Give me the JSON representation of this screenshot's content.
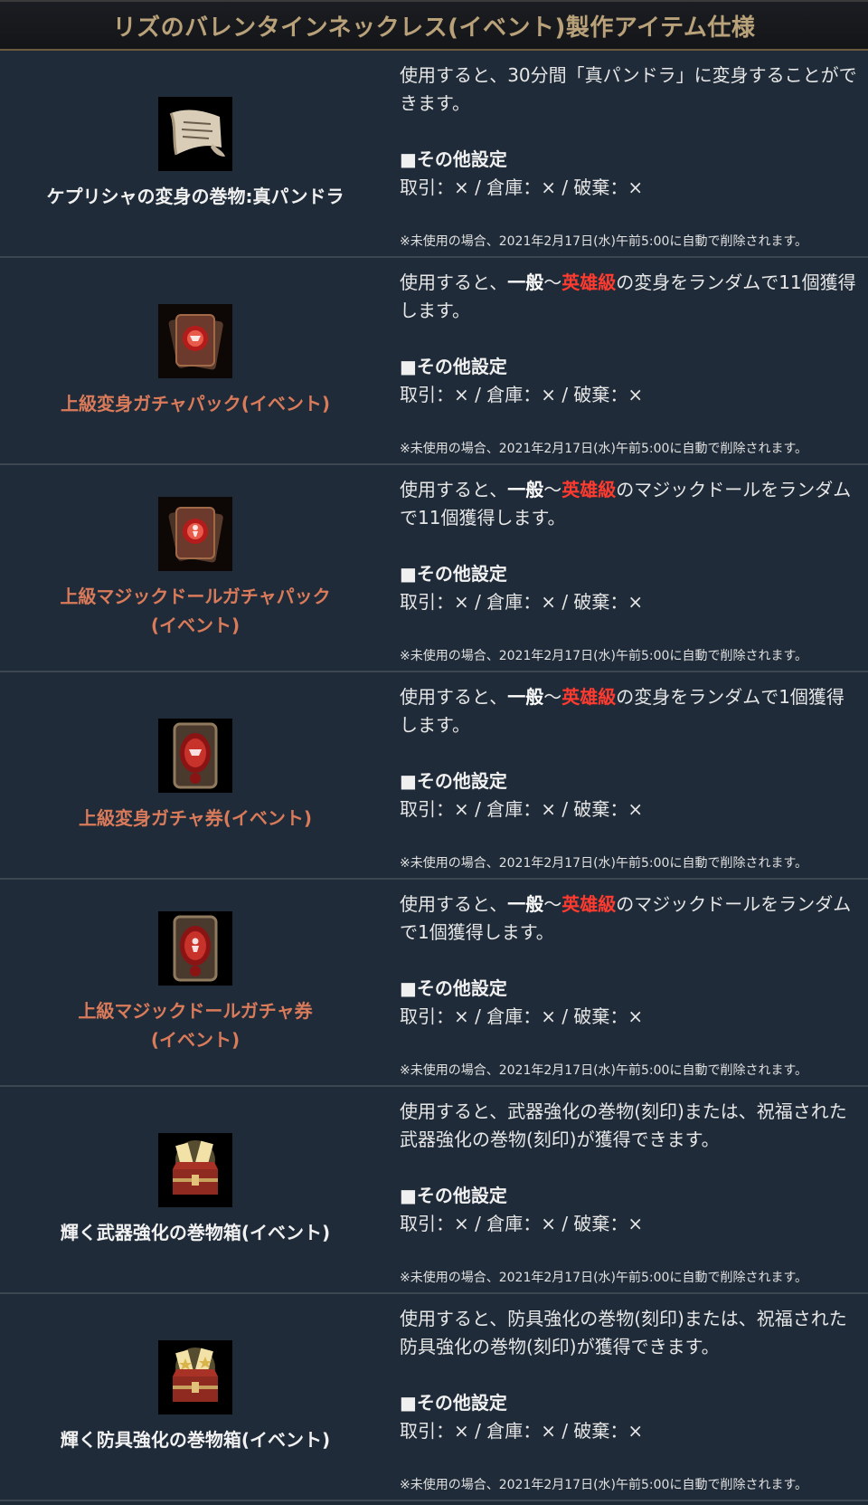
{
  "header": {
    "title": "リズのバレンタインネックレス(イベント)製作アイテム仕様"
  },
  "common": {
    "other_settings": "■その他設定",
    "trade_line": "取引：× / 倉庫：× / 破棄：×",
    "note": "※未使用の場合、2021年2月17日(水)午前5:00に自動で削除されます。"
  },
  "items": [
    {
      "name": "ケプリシャの変身の巻物:真パンドラ",
      "name_color": "white",
      "icon": "scroll-icon",
      "desc": [
        "使用すると、30分間「真パンドラ」に変身することができます。"
      ]
    },
    {
      "name": "上級変身ガチャパック(イベント)",
      "name_color": "orange",
      "icon": "card-pack-icon",
      "desc_pre": "使用すると、",
      "desc_bold": "一般",
      "desc_tilde": "～",
      "desc_red": "英雄級",
      "desc_post": "の変身をランダムで11個獲得します。"
    },
    {
      "name_line1": "上級マジックドールガチャパック",
      "name_line2": "(イベント)",
      "name_color": "orange",
      "icon": "doll-card-pack-icon",
      "desc_pre": "使用すると、",
      "desc_bold": "一般",
      "desc_tilde": "～",
      "desc_red": "英雄級",
      "desc_post": "のマジックドールをランダムで11個獲得します。"
    },
    {
      "name": "上級変身ガチャ券(イベント)",
      "name_color": "orange",
      "icon": "transform-ticket-icon",
      "desc_pre": "使用すると、",
      "desc_bold": "一般",
      "desc_tilde": "～",
      "desc_red": "英雄級",
      "desc_post": "の変身をランダムで1個獲得します。"
    },
    {
      "name_line1": "上級マジックドールガチャ券",
      "name_line2": "(イベント)",
      "name_color": "orange",
      "icon": "doll-ticket-icon",
      "desc_pre": "使用すると、",
      "desc_bold": "一般",
      "desc_tilde": "～",
      "desc_red": "英雄級",
      "desc_post": "のマジックドールをランダムで1個獲得します。"
    },
    {
      "name": "輝く武器強化の巻物箱(イベント)",
      "name_color": "white",
      "icon": "treasure-chest-icon",
      "desc": [
        "使用すると、武器強化の巻物(刻印)または、祝福された武器強化の巻物(刻印)が獲得できます。"
      ]
    },
    {
      "name": "輝く防具強化の巻物箱(イベント)",
      "name_color": "white",
      "icon": "treasure-chest-icon",
      "desc": [
        "使用すると、防具強化の巻物(刻印)または、祝福された防具強化の巻物(刻印)が獲得できます。"
      ]
    }
  ]
}
